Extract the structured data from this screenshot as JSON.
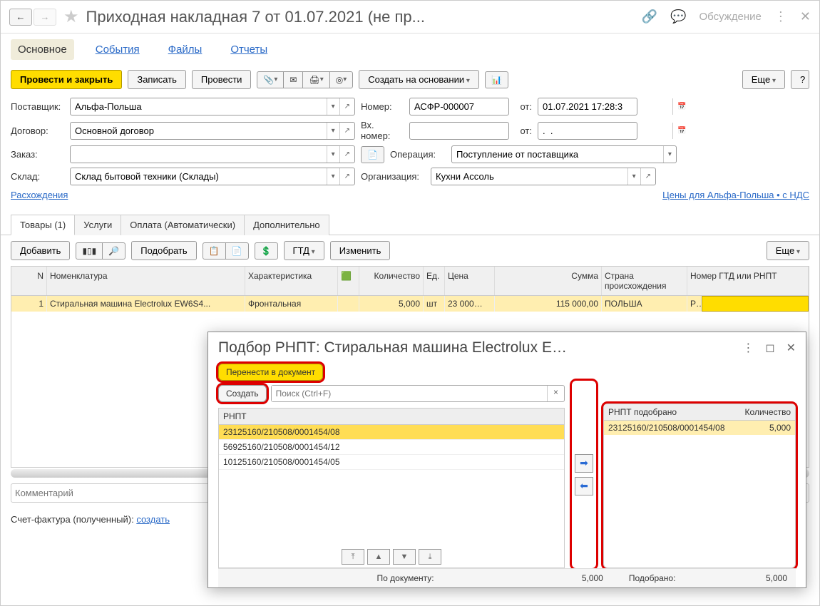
{
  "titlebar": {
    "title": "Приходная накладная 7 от 01.07.2021 (не пр...",
    "discuss": "Обсуждение"
  },
  "tabs": [
    "Основное",
    "События",
    "Файлы",
    "Отчеты"
  ],
  "toolbar": {
    "post_close": "Провести и закрыть",
    "save": "Записать",
    "post": "Провести",
    "create_based": "Создать на основании",
    "more": "Еще",
    "help": "?"
  },
  "labels": {
    "supplier": "Поставщик:",
    "contract": "Договор:",
    "order": "Заказ:",
    "warehouse": "Склад:",
    "number": "Номер:",
    "from": "от:",
    "ext_number": "Вх. номер:",
    "operation": "Операция:",
    "organization": "Организация:",
    "diffs": "Расхождения",
    "prices_link": "Цены для Альфа-Польша • с НДС"
  },
  "fields": {
    "supplier": "Альфа-Польша",
    "contract": "Основной договор",
    "order": "",
    "warehouse": "Склад бытовой техники (Склады)",
    "number": "АСФР-000007",
    "date": "01.07.2021 17:28:3",
    "ext_number": "",
    "ext_date": ".  .",
    "operation": "Поступление от поставщика",
    "organization": "Кухни Ассоль"
  },
  "subtabs": [
    "Товары (1)",
    "Услуги",
    "Оплата (Автоматически)",
    "Дополнительно"
  ],
  "subtoolbar": {
    "add": "Добавить",
    "pick": "Подобрать",
    "gtd": "ГТД",
    "edit": "Изменить",
    "more": "Еще"
  },
  "grid": {
    "headers": {
      "n": "N",
      "nom": "Номенклатура",
      "char": "Характеристика",
      "qty": "Количество",
      "unit": "Ед.",
      "price": "Цена",
      "sum": "Сумма",
      "country": "Страна происхождения",
      "gtd": "Номер ГТД или РНПТ"
    },
    "row": {
      "n": "1",
      "nom": "Стиральная машина Electrolux EW6S4...",
      "char": "Фронтальная",
      "qty": "5,000",
      "unit": "шт",
      "price": "23 000…",
      "sum": "115 000,00",
      "country": "ПОЛЬША",
      "gtd_short": "Р…"
    }
  },
  "comment_placeholder": "Комментарий",
  "sf": {
    "label": "Счет-фактура (полученный):",
    "create": "создать"
  },
  "dialog": {
    "title": "Подбор РНПТ: Стиральная машина Electrolux E…",
    "transfer": "Перенести в документ",
    "create": "Создать",
    "search_ph": "Поиск (Ctrl+F)",
    "list_header": "РНПТ",
    "list": [
      "23125160/210508/0001454/08",
      "56925160/210508/0001454/12",
      "10125160/210508/0001454/05"
    ],
    "right_h1": "РНПТ подобрано",
    "right_h2": "Количество",
    "right_row": {
      "rnpt": "23125160/210508/0001454/08",
      "qty": "5,000"
    },
    "foot_doc": "По документу:",
    "foot_doc_val": "5,000",
    "foot_pick": "Подобрано:",
    "foot_pick_val": "5,000"
  }
}
